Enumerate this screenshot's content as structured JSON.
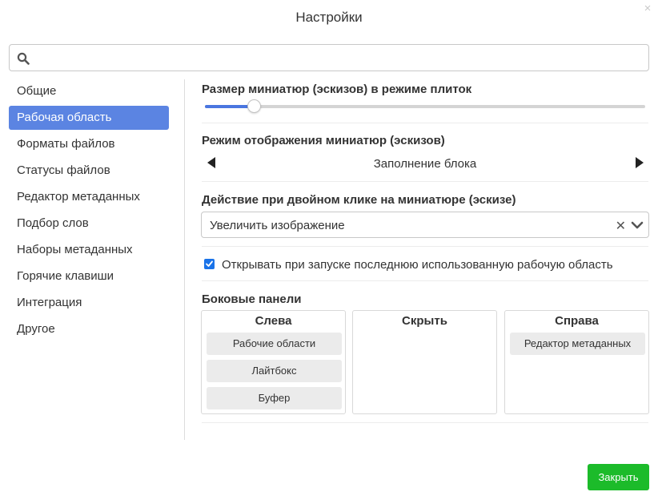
{
  "dialog": {
    "title": "Настройки",
    "close_icon": "×"
  },
  "search": {
    "placeholder": "",
    "value": ""
  },
  "sidebar": {
    "items": [
      {
        "label": "Общие",
        "active": false
      },
      {
        "label": "Рабочая область",
        "active": true
      },
      {
        "label": "Форматы файлов",
        "active": false
      },
      {
        "label": "Статусы файлов",
        "active": false
      },
      {
        "label": "Редактор метаданных",
        "active": false
      },
      {
        "label": "Подбор слов",
        "active": false
      },
      {
        "label": "Наборы метаданных",
        "active": false
      },
      {
        "label": "Горячие клавиши",
        "active": false
      },
      {
        "label": "Интеграция",
        "active": false
      },
      {
        "label": "Другое",
        "active": false
      }
    ]
  },
  "thumb_size": {
    "label": "Размер миниатюр (эскизов) в режиме плиток",
    "slider_fraction": 0.11
  },
  "thumb_mode": {
    "label": "Режим отображения миниатюр (эскизов)",
    "value": "Заполнение блока"
  },
  "dblclick": {
    "label": "Действие при двойном клике на миниатюре (эскизе)",
    "value": "Увеличить изображение",
    "clear_icon": "✕"
  },
  "open_last": {
    "label": "Открывать при запуске последнюю использованную рабочую область",
    "checked": true
  },
  "side_panels": {
    "label": "Боковые панели",
    "left": {
      "title": "Слева",
      "items": [
        "Рабочие области",
        "Лайтбокс",
        "Буфер"
      ]
    },
    "hidden": {
      "title": "Скрыть",
      "items": []
    },
    "right": {
      "title": "Справа",
      "items": [
        "Редактор метаданных"
      ]
    }
  },
  "footer": {
    "close_label": "Закрыть"
  },
  "colors": {
    "accent": "#5b84e2",
    "slider": "#4a76e0",
    "close_button": "#1cbb2a",
    "checkbox": "#1a73e8"
  }
}
